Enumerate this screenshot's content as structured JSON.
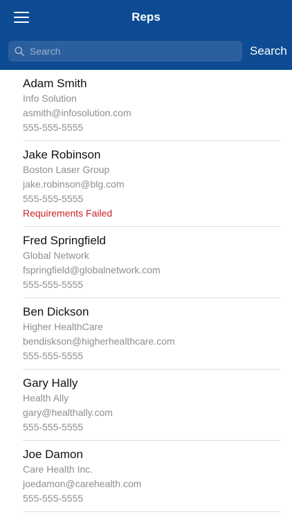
{
  "header": {
    "title": "Reps",
    "menu_icon": "hamburger-menu-icon",
    "background_color": "#0d4c93"
  },
  "search": {
    "placeholder": "Search",
    "value": "",
    "button_label": "Search",
    "icon": "search-icon"
  },
  "reps": [
    {
      "name": "Adam Smith",
      "company": "Info Solution",
      "email": "asmith@infosolution.com",
      "phone": "555-555-5555",
      "alert": ""
    },
    {
      "name": "Jake Robinson",
      "company": "Boston Laser Group",
      "email": "jake.robinson@blg.com",
      "phone": "555-555-5555",
      "alert": "Requirements Failed"
    },
    {
      "name": "Fred Springfield",
      "company": "Global Network",
      "email": "fspringfield@globalnetwork.com",
      "phone": "555-555-5555",
      "alert": ""
    },
    {
      "name": "Ben Dickson",
      "company": "Higher HealthCare",
      "email": "bendiskson@higherhealthcare.com",
      "phone": "555-555-5555",
      "alert": ""
    },
    {
      "name": "Gary Hally",
      "company": "Health Ally",
      "email": "gary@healthally.com",
      "phone": "555-555-5555",
      "alert": ""
    },
    {
      "name": "Joe Damon",
      "company": "Care Health Inc.",
      "email": "joedamon@carehealth.com",
      "phone": "555-555-5555",
      "alert": ""
    }
  ],
  "colors": {
    "alert": "#c8222a",
    "secondary_text": "#8e8e8e"
  }
}
